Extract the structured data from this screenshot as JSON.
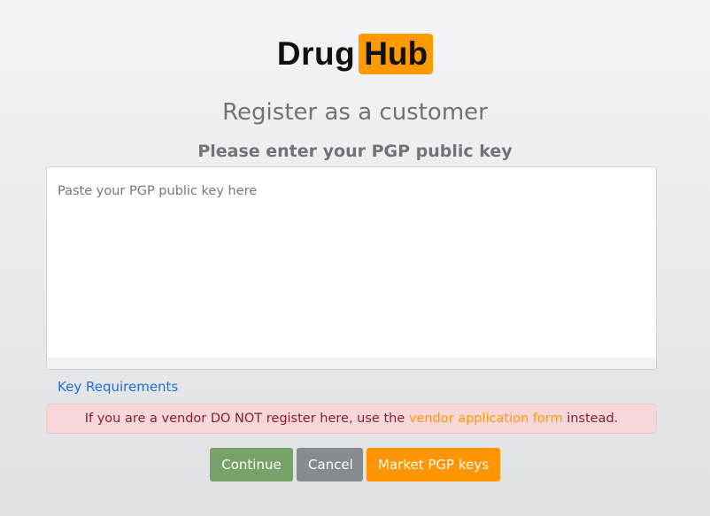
{
  "logo": {
    "part1": "Drug",
    "part2": "Hub"
  },
  "heading": {
    "title": "Register as a customer",
    "subtitle": "Please enter your PGP public key"
  },
  "pgp_input": {
    "value": "",
    "placeholder": "Paste your PGP public key here"
  },
  "links": {
    "key_requirements": "Key Requirements"
  },
  "alert": {
    "text_before": "If you are a vendor DO NOT register here, use the ",
    "link_text": "vendor application form",
    "text_after": " instead."
  },
  "buttons": {
    "continue_label": "Continue",
    "cancel_label": "Cancel",
    "market_pgp_label": "Market PGP keys"
  },
  "colors": {
    "brand_orange": "#ff9900",
    "continue_green": "#77a36b",
    "cancel_gray": "#868b90",
    "alert_bg": "#f8d7da",
    "link_blue": "#1a73d9"
  }
}
